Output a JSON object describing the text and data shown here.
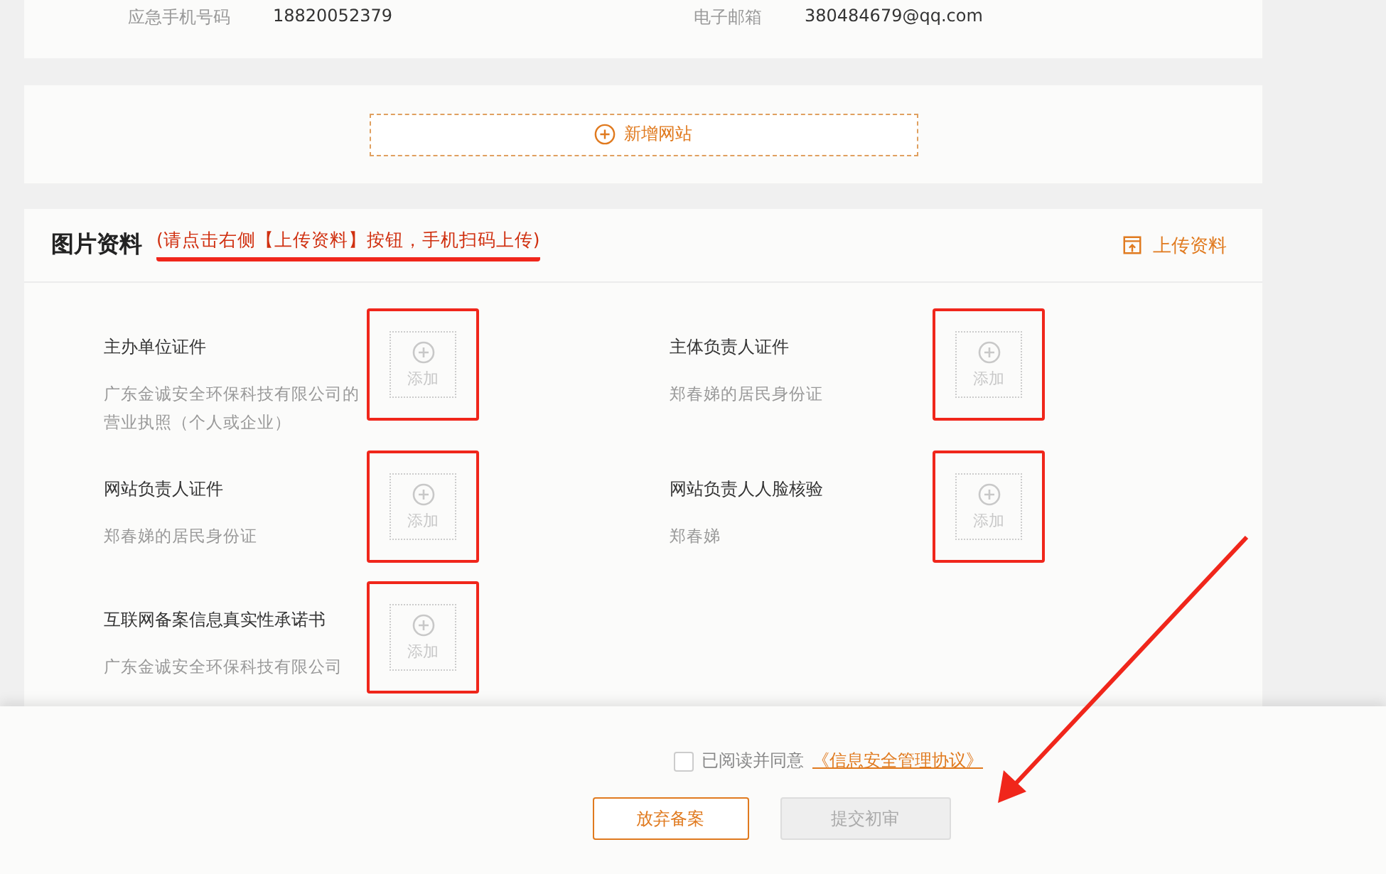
{
  "contact": [
    {
      "label": "应急手机号码",
      "value": "18820052379"
    },
    {
      "label": "电子邮箱",
      "value": "380484679@qq.com"
    }
  ],
  "add_website_button": {
    "label": "新增网站"
  },
  "images_section": {
    "title": "图片资料",
    "hint": "(请点击右侧【上传资料】按钮，手机扫码上传)",
    "hint_underlined": true,
    "upload_button": "上传资料",
    "items": [
      {
        "title": "主办单位证件",
        "description": "广东金诚安全环保科技有限公司的营业执照（个人或企业）",
        "add_label": "添加",
        "highlighted": true
      },
      {
        "title": "主体负责人证件",
        "description": "郑春娣的居民身份证",
        "add_label": "添加",
        "highlighted": true
      },
      {
        "title": "网站负责人证件",
        "description": "郑春娣的居民身份证",
        "add_label": "添加",
        "highlighted": true
      },
      {
        "title": "网站负责人人脸核验",
        "description": "郑春娣",
        "add_label": "添加",
        "highlighted": true
      },
      {
        "title": "互联网备案信息真实性承诺书",
        "description": "广东金诚安全环保科技有限公司",
        "add_label": "添加",
        "highlighted": true
      }
    ]
  },
  "footer": {
    "agreement": {
      "checked": false,
      "text": "已阅读并同意",
      "link": "《信息安全管理协议》"
    },
    "buttons": [
      {
        "label": "放弃备案",
        "disabled": false
      },
      {
        "label": "提交初审",
        "disabled": true
      }
    ]
  }
}
